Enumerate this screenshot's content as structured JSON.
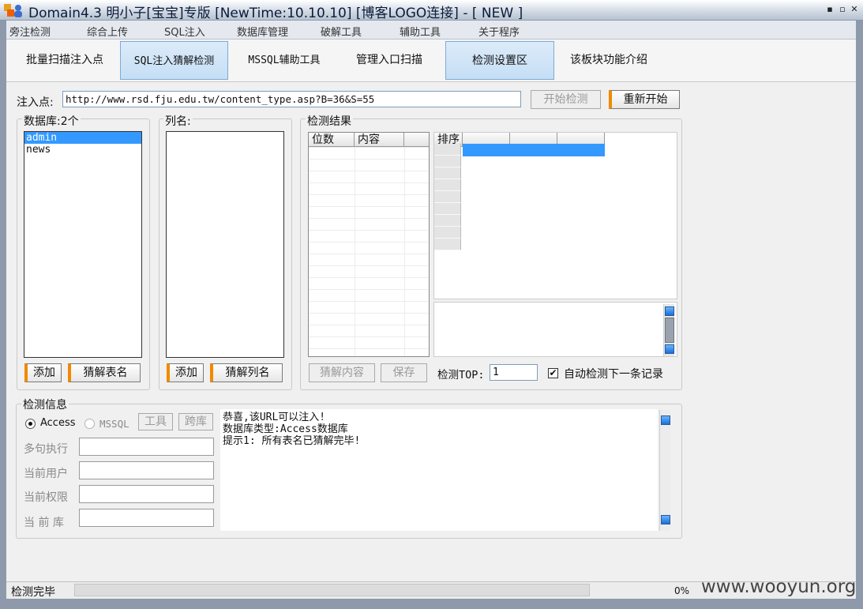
{
  "window": {
    "title": "Domain4.3 明小子[宝宝]专版 [NewTime:10.10.10] [博客LOGO连接] - [ NEW ]",
    "min": "▪",
    "max": "▫",
    "close": "✕"
  },
  "top_tabs": [
    "旁注检测",
    "综合上传",
    "SQL注入",
    "数据库管理",
    "破解工具",
    "辅助工具",
    "关于程序"
  ],
  "toolbar": {
    "items": [
      "批量扫描注入点",
      "SQL注入猜解检测",
      "MSSQL辅助工具",
      "管理入口扫描",
      "检测设置区",
      "该板块功能介绍"
    ],
    "selected": [
      "SQL注入猜解检测",
      "检测设置区"
    ]
  },
  "injection": {
    "label": "注入点:",
    "url": "http://www.rsd.fju.edu.tw/content_type.asp?B=36&S=55",
    "start_btn": "开始检测",
    "restart_btn": "重新开始"
  },
  "database": {
    "label": "数据库:2个",
    "tables": [
      "admin",
      "news"
    ],
    "selected_index": 0,
    "add_btn": "添加",
    "guess_btn": "猜解表名"
  },
  "columns": {
    "label": "列名:",
    "add_btn": "添加",
    "guess_btn": "猜解列名"
  },
  "results": {
    "label": "检测结果",
    "grid1_headers": [
      "位数",
      "内容"
    ],
    "grid2_header": "排序",
    "guess_content_btn": "猜解内容",
    "save_btn": "保存",
    "top_label": "检测TOP:",
    "top_value": "1",
    "auto_label": "自动检测下一条记录",
    "auto_checked": "✔"
  },
  "info": {
    "label": "检测信息",
    "db_access": "Access",
    "db_mssql": "MSSQL",
    "tool_btn": "工具",
    "cross_btn": "跨库",
    "fields": [
      "多句执行",
      "当前用户",
      "当前权限",
      "当 前 库"
    ],
    "log": [
      "恭喜,该URL可以注入!",
      "数据库类型:Access数据库",
      "提示1: 所有表名已猜解完毕!"
    ]
  },
  "status": {
    "text": "检测完毕",
    "progress": "0%"
  },
  "watermark": "www.wooyun.org"
}
